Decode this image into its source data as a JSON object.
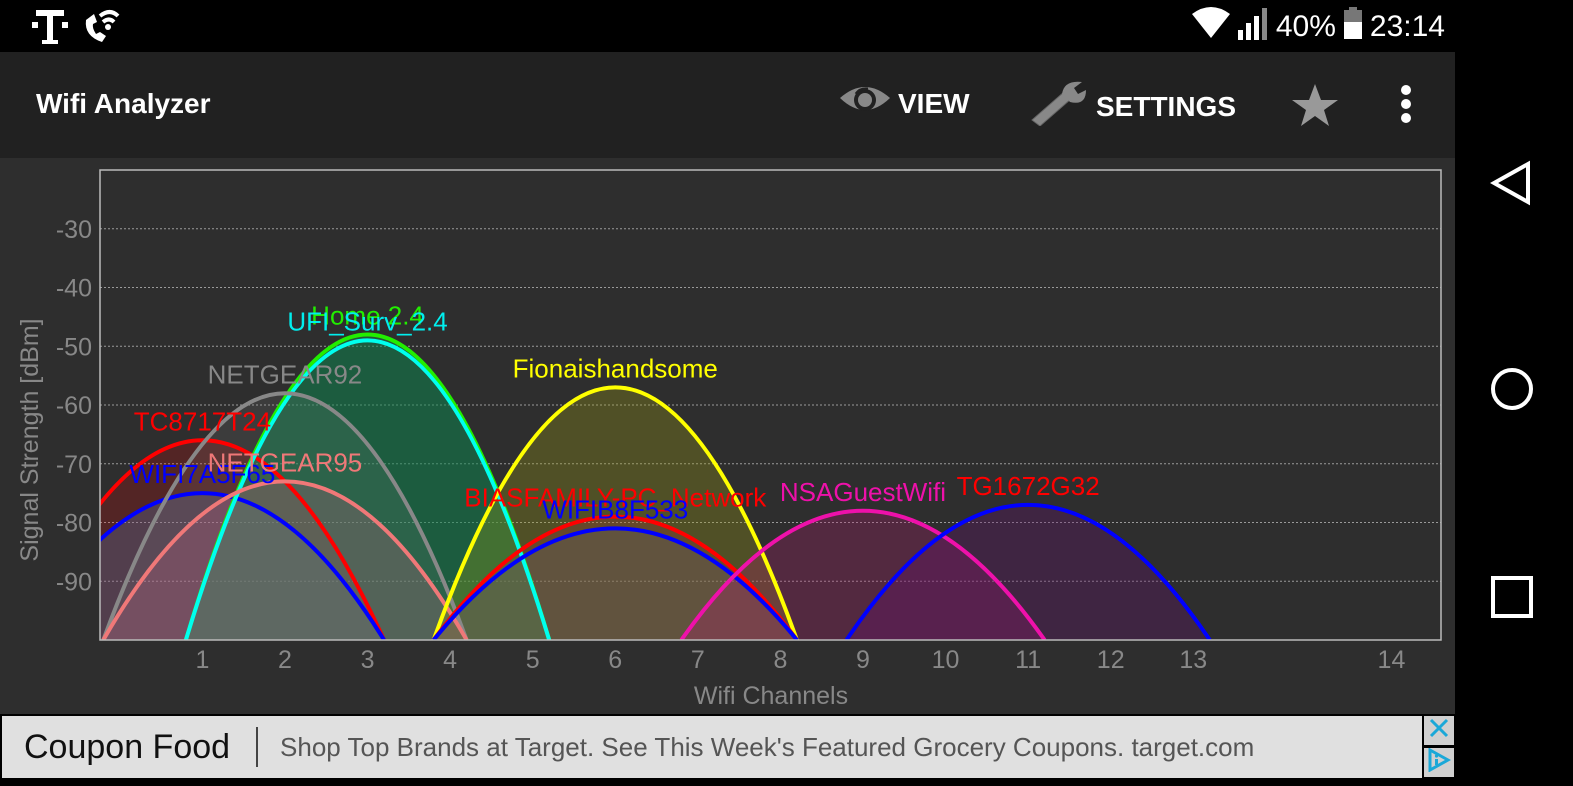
{
  "status_bar": {
    "carrier_icon": "t-mobile-logo-icon",
    "wifi_calling_icon": "wifi-calling-icon",
    "wifi_icon": "wifi-signal-icon",
    "cell_icon": "cell-signal-icon",
    "battery_percent": "40%",
    "battery_icon": "battery-icon",
    "time": "23:14"
  },
  "app_bar": {
    "title": "Wifi Analyzer",
    "view_label": "VIEW",
    "settings_label": "SETTINGS",
    "star_icon": "star-icon",
    "overflow_icon": "more-vert-icon"
  },
  "nav_bar": {
    "back": "back-icon",
    "home": "home-icon",
    "recents": "recents-icon"
  },
  "chart_data": {
    "type": "area",
    "title": "",
    "xlabel": "Wifi Channels",
    "ylabel": "Signal Strength [dBm]",
    "xlim": [
      -0.24,
      16.0
    ],
    "ylim": [
      -100,
      -20
    ],
    "x_ticks": [
      {
        "value": 1,
        "label": "1"
      },
      {
        "value": 2,
        "label": "2"
      },
      {
        "value": 3,
        "label": "3"
      },
      {
        "value": 4,
        "label": "4"
      },
      {
        "value": 5,
        "label": "5"
      },
      {
        "value": 6,
        "label": "6"
      },
      {
        "value": 7,
        "label": "7"
      },
      {
        "value": 8,
        "label": "8"
      },
      {
        "value": 9,
        "label": "9"
      },
      {
        "value": 10,
        "label": "10"
      },
      {
        "value": 11,
        "label": "11"
      },
      {
        "value": 12,
        "label": "12"
      },
      {
        "value": 13,
        "label": "13"
      },
      {
        "value": 15.4,
        "label": "14"
      }
    ],
    "y_ticks": [
      -30,
      -40,
      -50,
      -60,
      -70,
      -80,
      -90
    ],
    "grid": true,
    "channel_half_width": 2.2,
    "series": [
      {
        "name": "TC8717T24",
        "channel": 1,
        "peak_dbm": -66,
        "line_color": "#ff0000",
        "label_color": "#ff0000",
        "fill": "rgba(255,0,0,0.18)"
      },
      {
        "name": "WIFI7A5F65",
        "channel": 1,
        "peak_dbm": -75,
        "line_color": "#0000ff",
        "label_color": "#0000ff",
        "fill": "rgba(80,140,200,0.25)"
      },
      {
        "name": "Home 2.4",
        "channel": 3,
        "peak_dbm": -48,
        "line_color": "#22ee00",
        "label_color": "#22ee00",
        "fill": "rgba(20,140,70,0.45)"
      },
      {
        "name": "UFI_Surv_2.4",
        "channel": 3,
        "peak_dbm": -49,
        "line_color": "#00ffee",
        "label_color": "#00eeee",
        "fill": "rgba(0,120,100,0.15)"
      },
      {
        "name": "NETGEAR92",
        "channel": 2,
        "peak_dbm": -58,
        "line_color": "#888888",
        "label_color": "#888888",
        "fill": "rgba(140,140,140,0.15)"
      },
      {
        "name": "NETGEAR95",
        "channel": 2,
        "peak_dbm": -73,
        "line_color": "#f07878",
        "label_color": "#f07878",
        "fill": "rgba(200,100,130,0.25)"
      },
      {
        "name": "Fionaishandsome",
        "channel": 6,
        "peak_dbm": -57,
        "line_color": "#ffff00",
        "label_color": "#ffff00",
        "fill": "rgba(160,160,20,0.3)"
      },
      {
        "name": "BIASFAMILY-PC_Network",
        "channel": 6,
        "peak_dbm": -79,
        "line_color": "#ff0000",
        "label_color": "#ff0000",
        "fill": "rgba(200,40,60,0.18)"
      },
      {
        "name": "WIFIB8F533",
        "channel": 6,
        "peak_dbm": -81,
        "line_color": "#0000ff",
        "label_color": "#0000ff",
        "fill": "rgba(90,110,110,0.3)"
      },
      {
        "name": "NSAGuestWifi",
        "channel": 9,
        "peak_dbm": -78,
        "line_color": "#ee11aa",
        "label_color": "#ee11aa",
        "fill": "rgba(180,30,110,0.28)"
      },
      {
        "name": "TG1672G32",
        "channel": 11,
        "peak_dbm": -77,
        "line_color": "#0000ff",
        "label_color": "#ff0000",
        "fill": "rgba(100,20,110,0.32)"
      }
    ]
  },
  "ad": {
    "title": "Coupon Food",
    "text": "Shop Top Brands at Target. See This Week's Featured Grocery Coupons. target.com",
    "close_icon": "close-icon",
    "adchoices_icon": "adchoices-icon"
  }
}
